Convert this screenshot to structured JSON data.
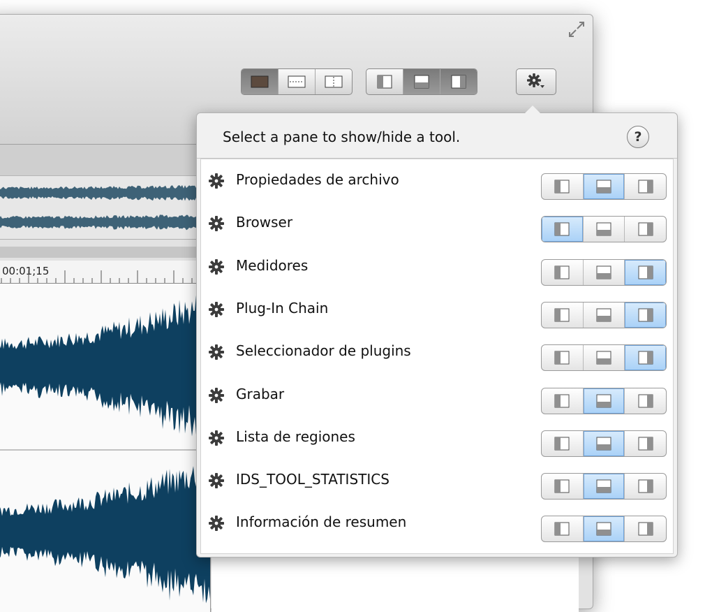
{
  "window": {
    "timeline": {
      "ruler_label": "00:01;15"
    }
  },
  "popover": {
    "title": "Select a pane to show/hide a tool.",
    "help_label": "?",
    "tools": [
      {
        "label": "Propiedades de archivo",
        "selected_pane": "bottom"
      },
      {
        "label": "Browser",
        "selected_pane": "left"
      },
      {
        "label": "Medidores",
        "selected_pane": "right"
      },
      {
        "label": "Plug-In Chain",
        "selected_pane": "right"
      },
      {
        "label": "Seleccionador de plugins",
        "selected_pane": "right"
      },
      {
        "label": "Grabar",
        "selected_pane": "bottom"
      },
      {
        "label": "Lista de regiones",
        "selected_pane": "bottom"
      },
      {
        "label": "IDS_TOOL_STATISTICS",
        "selected_pane": "bottom"
      },
      {
        "label": "Información de resumen",
        "selected_pane": "bottom"
      }
    ]
  },
  "colors": {
    "waveform": "#0e4060",
    "overview_waveform": "#3e6277",
    "selected_segment": "#a9d1f7"
  },
  "icons": {
    "tool_row": "gear-icon",
    "toolbar_pane_button": "gear-dropdown-icon",
    "help": "help-icon",
    "fullscreen": "fullscreen-icon"
  }
}
